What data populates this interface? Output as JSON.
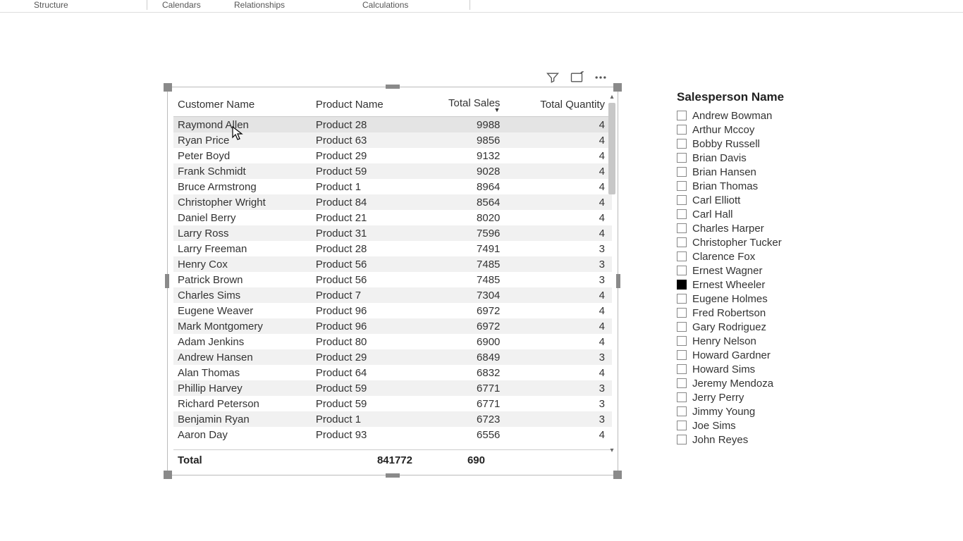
{
  "ribbon": {
    "groups": [
      "Structure",
      "Calendars",
      "Relationships",
      "Calculations"
    ]
  },
  "visual_icons": {
    "filter": "filter-icon",
    "focus": "focus-mode-icon",
    "more": "more-options-icon"
  },
  "table": {
    "columns": [
      {
        "label": "Customer Name",
        "align": "left"
      },
      {
        "label": "Product Name",
        "align": "left"
      },
      {
        "label": "Total Sales",
        "align": "right",
        "sorted": "desc"
      },
      {
        "label": "Total Quantity",
        "align": "right"
      }
    ],
    "rows": [
      {
        "customer": "Raymond Allen",
        "product": "Product 28",
        "sales": "9988",
        "qty": "4",
        "hover": true
      },
      {
        "customer": "Ryan Price",
        "product": "Product 63",
        "sales": "9856",
        "qty": "4"
      },
      {
        "customer": "Peter Boyd",
        "product": "Product 29",
        "sales": "9132",
        "qty": "4"
      },
      {
        "customer": "Frank Schmidt",
        "product": "Product 59",
        "sales": "9028",
        "qty": "4"
      },
      {
        "customer": "Bruce Armstrong",
        "product": "Product 1",
        "sales": "8964",
        "qty": "4"
      },
      {
        "customer": "Christopher Wright",
        "product": "Product 84",
        "sales": "8564",
        "qty": "4"
      },
      {
        "customer": "Daniel Berry",
        "product": "Product 21",
        "sales": "8020",
        "qty": "4"
      },
      {
        "customer": "Larry Ross",
        "product": "Product 31",
        "sales": "7596",
        "qty": "4"
      },
      {
        "customer": "Larry Freeman",
        "product": "Product 28",
        "sales": "7491",
        "qty": "3"
      },
      {
        "customer": "Henry Cox",
        "product": "Product 56",
        "sales": "7485",
        "qty": "3"
      },
      {
        "customer": "Patrick Brown",
        "product": "Product 56",
        "sales": "7485",
        "qty": "3"
      },
      {
        "customer": "Charles Sims",
        "product": "Product 7",
        "sales": "7304",
        "qty": "4"
      },
      {
        "customer": "Eugene Weaver",
        "product": "Product 96",
        "sales": "6972",
        "qty": "4"
      },
      {
        "customer": "Mark Montgomery",
        "product": "Product 96",
        "sales": "6972",
        "qty": "4"
      },
      {
        "customer": "Adam Jenkins",
        "product": "Product 80",
        "sales": "6900",
        "qty": "4"
      },
      {
        "customer": "Andrew Hansen",
        "product": "Product 29",
        "sales": "6849",
        "qty": "3"
      },
      {
        "customer": "Alan Thomas",
        "product": "Product 64",
        "sales": "6832",
        "qty": "4"
      },
      {
        "customer": "Phillip Harvey",
        "product": "Product 59",
        "sales": "6771",
        "qty": "3"
      },
      {
        "customer": "Richard Peterson",
        "product": "Product 59",
        "sales": "6771",
        "qty": "3"
      },
      {
        "customer": "Benjamin Ryan",
        "product": "Product 1",
        "sales": "6723",
        "qty": "3"
      },
      {
        "customer": "Aaron Day",
        "product": "Product 93",
        "sales": "6556",
        "qty": "4"
      }
    ],
    "totals": {
      "label": "Total",
      "sales": "841772",
      "qty": "690"
    }
  },
  "slicer": {
    "title": "Salesperson Name",
    "items": [
      {
        "name": "Andrew Bowman",
        "checked": false
      },
      {
        "name": "Arthur Mccoy",
        "checked": false
      },
      {
        "name": "Bobby Russell",
        "checked": false
      },
      {
        "name": "Brian Davis",
        "checked": false
      },
      {
        "name": "Brian Hansen",
        "checked": false
      },
      {
        "name": "Brian Thomas",
        "checked": false
      },
      {
        "name": "Carl Elliott",
        "checked": false
      },
      {
        "name": "Carl Hall",
        "checked": false
      },
      {
        "name": "Charles Harper",
        "checked": false
      },
      {
        "name": "Christopher Tucker",
        "checked": false
      },
      {
        "name": "Clarence Fox",
        "checked": false
      },
      {
        "name": "Ernest Wagner",
        "checked": false
      },
      {
        "name": "Ernest Wheeler",
        "checked": true
      },
      {
        "name": "Eugene Holmes",
        "checked": false
      },
      {
        "name": "Fred Robertson",
        "checked": false
      },
      {
        "name": "Gary Rodriguez",
        "checked": false
      },
      {
        "name": "Henry Nelson",
        "checked": false
      },
      {
        "name": "Howard Gardner",
        "checked": false
      },
      {
        "name": "Howard Sims",
        "checked": false
      },
      {
        "name": "Jeremy Mendoza",
        "checked": false
      },
      {
        "name": "Jerry Perry",
        "checked": false
      },
      {
        "name": "Jimmy Young",
        "checked": false
      },
      {
        "name": "Joe Sims",
        "checked": false
      },
      {
        "name": "John Reyes",
        "checked": false
      }
    ]
  }
}
